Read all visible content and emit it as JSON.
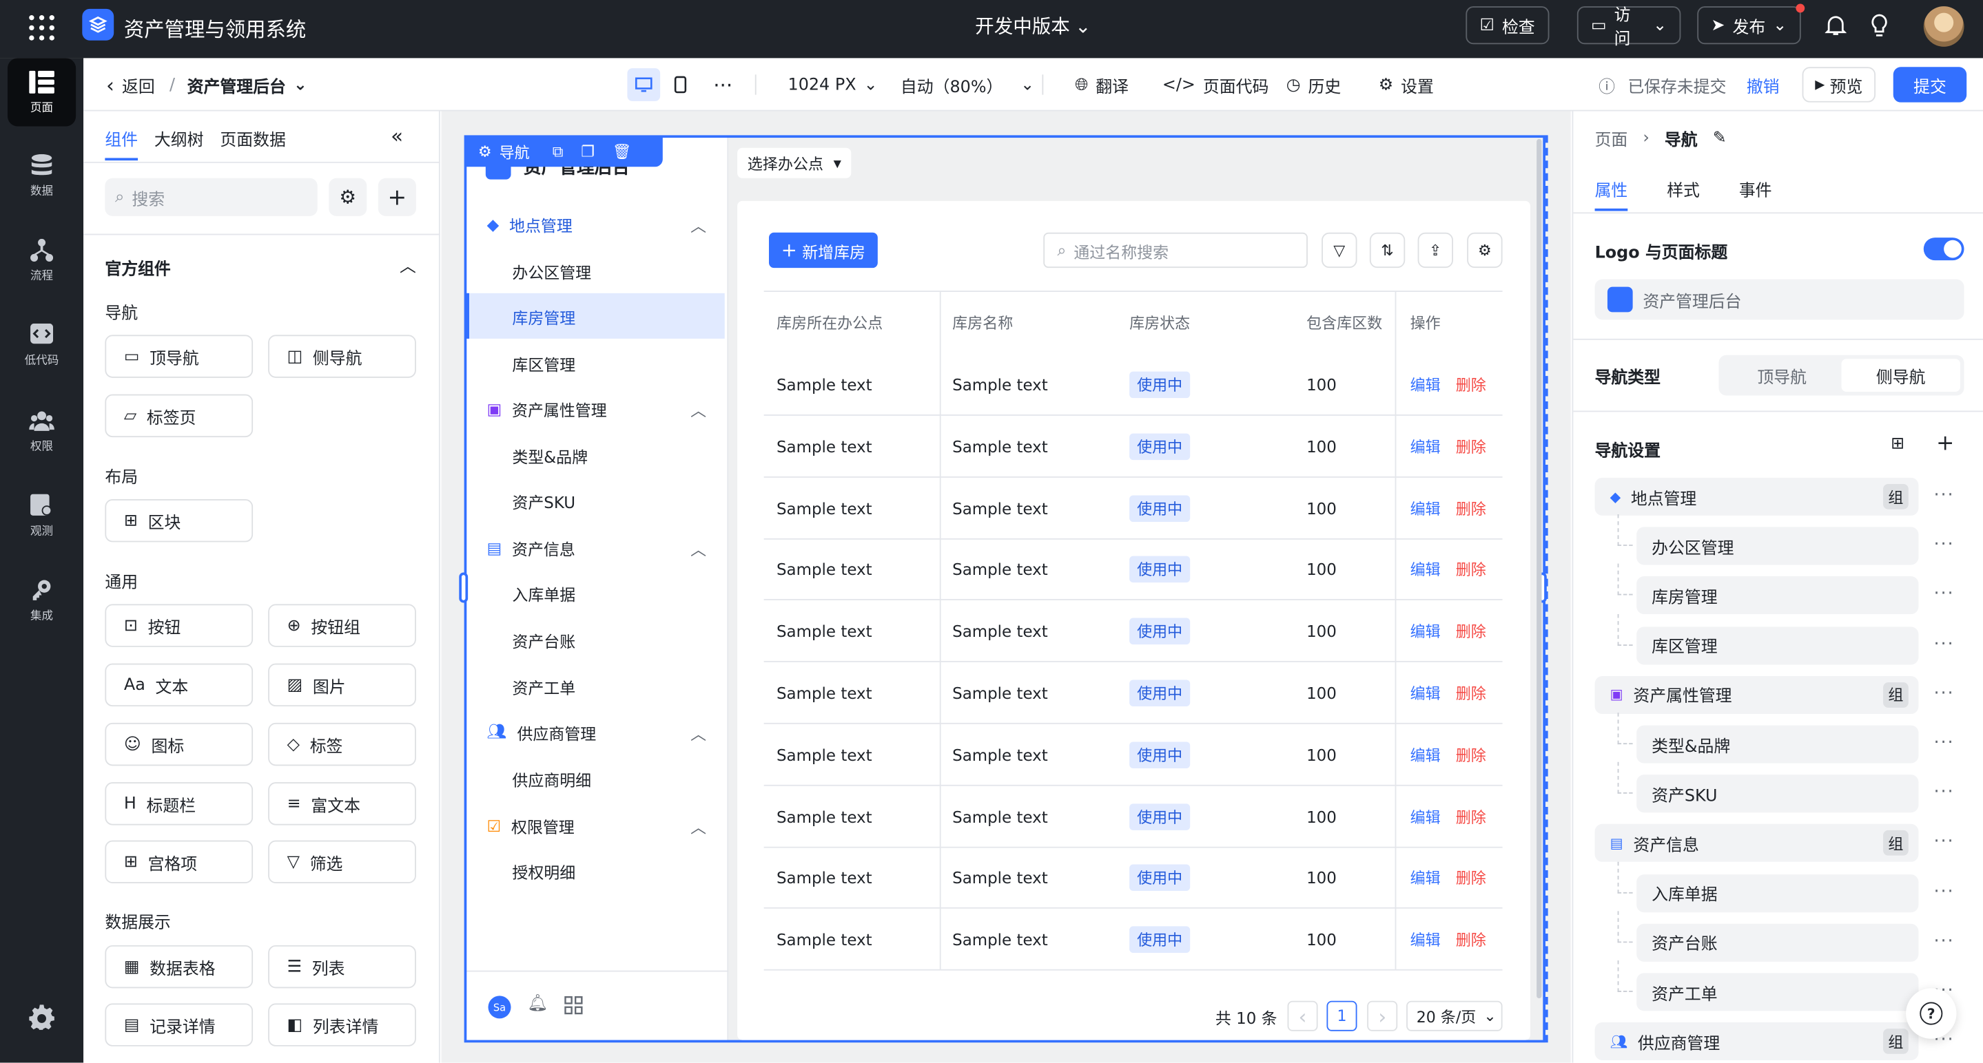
{
  "app": {
    "title": "资产管理与领用系统",
    "version": "开发中版本",
    "check": "检查",
    "visit": "访问",
    "publish": "发布"
  },
  "rail": [
    {
      "label": "页面"
    },
    {
      "label": "数据"
    },
    {
      "label": "流程"
    },
    {
      "label": "低代码"
    },
    {
      "label": "权限"
    },
    {
      "label": "观测"
    },
    {
      "label": "集成"
    }
  ],
  "toolbar": {
    "back": "返回",
    "page_name": "资产管理后台",
    "width": "1024 PX",
    "zoom": "自动（80%）",
    "translate": "翻译",
    "code": "页面代码",
    "history": "历史",
    "settings": "设置",
    "saved_status": "已保存未提交",
    "undo": "撤销",
    "preview": "预览",
    "submit": "提交"
  },
  "left": {
    "tabs": [
      "组件",
      "大纲树",
      "页面数据"
    ],
    "search_placeholder": "搜索",
    "section": "官方组件",
    "groups": {
      "nav": "导航",
      "layout": "布局",
      "common": "通用",
      "display": "数据展示"
    },
    "items": [
      "顶导航",
      "侧导航",
      "标签页",
      "区块",
      "按钮",
      "按钮组",
      "文本",
      "图片",
      "图标",
      "标签",
      "标题栏",
      "富文本",
      "宫格项",
      "筛选",
      "数据表格",
      "列表",
      "记录详情",
      "列表详情"
    ]
  },
  "canvas": {
    "sel_label": "导航",
    "nav_title": "资产管理后台",
    "office_select": "选择办公点",
    "nav": [
      {
        "label": "地点管理",
        "type": "group"
      },
      {
        "label": "办公区管理"
      },
      {
        "label": "库房管理",
        "active": true
      },
      {
        "label": "库区管理"
      },
      {
        "label": "资产属性管理",
        "type": "group"
      },
      {
        "label": "类型&品牌"
      },
      {
        "label": "资产SKU"
      },
      {
        "label": "资产信息",
        "type": "group"
      },
      {
        "label": "入库单据"
      },
      {
        "label": "资产台账"
      },
      {
        "label": "资产工单"
      },
      {
        "label": "供应商管理",
        "type": "group"
      },
      {
        "label": "供应商明细"
      },
      {
        "label": "权限管理",
        "type": "group"
      },
      {
        "label": "授权明细"
      }
    ],
    "avatar": "Sa",
    "add_button": "新增库房",
    "search_placeholder": "通过名称搜索",
    "columns": [
      "库房所在办公点",
      "库房名称",
      "库房状态",
      "包含库区数",
      "操作"
    ],
    "rows": [
      {
        "office": "Sample text",
        "name": "Sample text",
        "status": "使用中",
        "count": "100",
        "edit": "编辑",
        "del": "删除"
      },
      {
        "office": "Sample text",
        "name": "Sample text",
        "status": "使用中",
        "count": "100",
        "edit": "编辑",
        "del": "删除"
      },
      {
        "office": "Sample text",
        "name": "Sample text",
        "status": "使用中",
        "count": "100",
        "edit": "编辑",
        "del": "删除"
      },
      {
        "office": "Sample text",
        "name": "Sample text",
        "status": "使用中",
        "count": "100",
        "edit": "编辑",
        "del": "删除"
      },
      {
        "office": "Sample text",
        "name": "Sample text",
        "status": "使用中",
        "count": "100",
        "edit": "编辑",
        "del": "删除"
      },
      {
        "office": "Sample text",
        "name": "Sample text",
        "status": "使用中",
        "count": "100",
        "edit": "编辑",
        "del": "删除"
      },
      {
        "office": "Sample text",
        "name": "Sample text",
        "status": "使用中",
        "count": "100",
        "edit": "编辑",
        "del": "删除"
      },
      {
        "office": "Sample text",
        "name": "Sample text",
        "status": "使用中",
        "count": "100",
        "edit": "编辑",
        "del": "删除"
      },
      {
        "office": "Sample text",
        "name": "Sample text",
        "status": "使用中",
        "count": "100",
        "edit": "编辑",
        "del": "删除"
      },
      {
        "office": "Sample text",
        "name": "Sample text",
        "status": "使用中",
        "count": "100",
        "edit": "编辑",
        "del": "删除"
      }
    ],
    "total": "共 10 条",
    "page": "1",
    "page_size": "20 条/页"
  },
  "right": {
    "crumb_root": "页面",
    "crumb_current": "导航",
    "tabs": [
      "属性",
      "样式",
      "事件"
    ],
    "logo_title": "Logo 与页面标题",
    "logo_value": "资产管理后台",
    "nav_type": "导航类型",
    "nav_type_opts": [
      "顶导航",
      "侧导航"
    ],
    "nav_settings": "导航设置",
    "group_tag": "组",
    "tree": [
      {
        "label": "地点管理",
        "group": true
      },
      {
        "label": "办公区管理"
      },
      {
        "label": "库房管理"
      },
      {
        "label": "库区管理"
      },
      {
        "label": "资产属性管理",
        "group": true
      },
      {
        "label": "类型&品牌"
      },
      {
        "label": "资产SKU"
      },
      {
        "label": "资产信息",
        "group": true
      },
      {
        "label": "入库单据"
      },
      {
        "label": "资产台账"
      },
      {
        "label": "资产工单"
      },
      {
        "label": "供应商管理",
        "group": true
      }
    ]
  },
  "colors": {
    "primary": "#3370ff",
    "dark": "#1f2329",
    "danger": "#f54a45"
  }
}
